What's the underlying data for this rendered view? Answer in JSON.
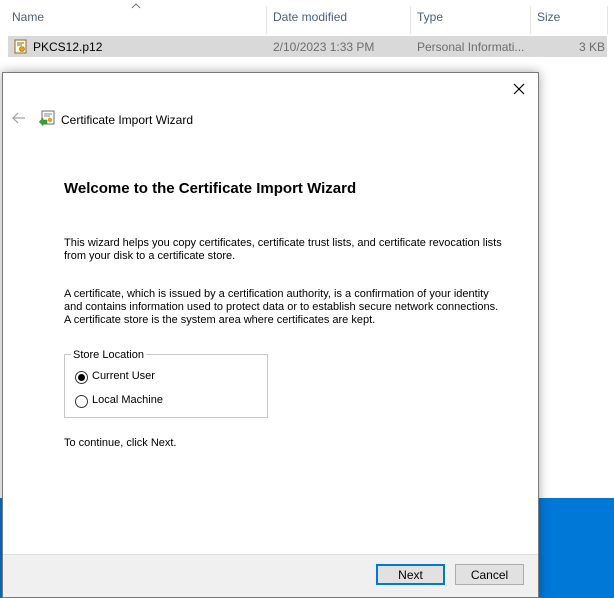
{
  "explorer": {
    "columns": {
      "name": "Name",
      "date_modified": "Date modified",
      "type": "Type",
      "size": "Size"
    },
    "files": [
      {
        "name": "PKCS12.p12",
        "date_modified": "2/10/2023 1:33 PM",
        "type": "Personal Informati...",
        "size": "3 KB"
      }
    ]
  },
  "dialog": {
    "title": "Certificate Import Wizard",
    "heading": "Welcome to the Certificate Import Wizard",
    "paragraph1": "This wizard helps you copy certificates, certificate trust lists, and certificate revocation lists from your disk to a certificate store.",
    "paragraph2": "A certificate, which is issued by a certification authority, is a confirmation of your identity and contains information used to protect data or to establish secure network connections. A certificate store is the system area where certificates are kept.",
    "store_location": {
      "label": "Store Location",
      "options": [
        {
          "label": "Current User",
          "checked": true
        },
        {
          "label": "Local Machine",
          "checked": false
        }
      ]
    },
    "continue_text": "To continue, click Next.",
    "buttons": {
      "next": "Next",
      "cancel": "Cancel"
    }
  },
  "colors": {
    "accent": "#0078d7",
    "header_text": "#4c607a",
    "desktop": "#0078d7"
  }
}
